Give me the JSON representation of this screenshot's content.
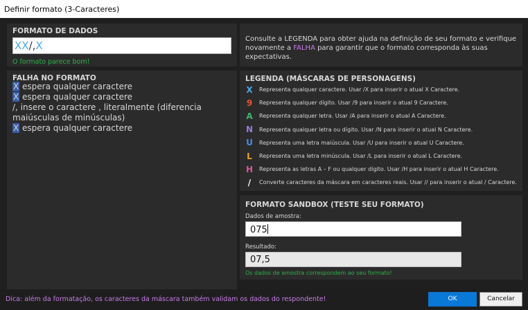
{
  "window": {
    "title": "Definir formato (3-Caracteres)"
  },
  "format_panel": {
    "heading": "FORMATO DE DADOS",
    "value_tokens": [
      "XX",
      "/",
      ",",
      "X"
    ],
    "status": "O formato parece bom!"
  },
  "consult": {
    "part1": "Consulte a LEGENDA para obter ajuda na definição de seu formato e verifique novamente a ",
    "highlight": "FALHA",
    "part2": " para garantir que o formato corresponda às suas expectativas."
  },
  "failure_panel": {
    "heading": "FALHA NO FORMATO",
    "items": [
      {
        "token": "X",
        "text": " espera qualquer caractere"
      },
      {
        "token": "X",
        "text": " espera qualquer caractere"
      },
      {
        "token": "/,",
        "text": " insere o caractere , literalmente (diferencia maiúsculas de minúsculas)"
      },
      {
        "token": "X",
        "text": " espera qualquer caractere"
      }
    ]
  },
  "legend": {
    "heading": "LEGENDA (MÁSCARAS DE PERSONAGENS)",
    "items": [
      {
        "glyph": "X",
        "color": "#4aa8e0",
        "text": "Representa qualquer caractere.  Usar /X  para inserir o atual X  Caractere."
      },
      {
        "glyph": "9",
        "color": "#e8552f",
        "text": "Representa qualquer dígito.  Usar /9  para inserir o atual 9  Caractere."
      },
      {
        "glyph": "A",
        "color": "#3fb56b",
        "text": "Representa qualquer letra.  Usar /A  para inserir o atual A  Caractere."
      },
      {
        "glyph": "N",
        "color": "#9a7ad8",
        "text": "Representa qualquer letra ou dígito.  Usar /N  para inserir o atual N  Caractere."
      },
      {
        "glyph": "U",
        "color": "#4a8ce0",
        "text": "Representa uma letra maiúscula.  Usar /U  para inserir o atual U  Caractere."
      },
      {
        "glyph": "L",
        "color": "#f0a21f",
        "text": "Representa uma letra minúscula.  Usar /L  para inserir o atual L  Caractere."
      },
      {
        "glyph": "H",
        "color": "#d8559a",
        "text": "Representa as letras A – F ou qualquer dígito.  Usar /H  para inserir o atual H  Caractere."
      },
      {
        "glyph": "/",
        "color": "#ffffff",
        "text": "Converte caracteres da máscara em caracteres reais.  Usar //  para inserir o atual /  Caractere."
      }
    ]
  },
  "sandbox": {
    "heading": "FORMATO SANDBOX (TESTE SEU FORMATO)",
    "sample_label": "Dados de amostra:",
    "sample_value": "075",
    "result_label": "Resultado:",
    "result_value": "07,5",
    "status": "Os dados de amostra correspondem ao seu formato!"
  },
  "footer": {
    "tip": "Dica: além da formatação, os caracteres da máscara também validam os dados do respondente!",
    "ok_label": "OK",
    "cancel_label": "Cancelar"
  },
  "colors": {
    "accent": "#0a78d7",
    "success": "#2fb14a",
    "highlight": "#c87de8",
    "token_x": "#4aa8e0"
  }
}
